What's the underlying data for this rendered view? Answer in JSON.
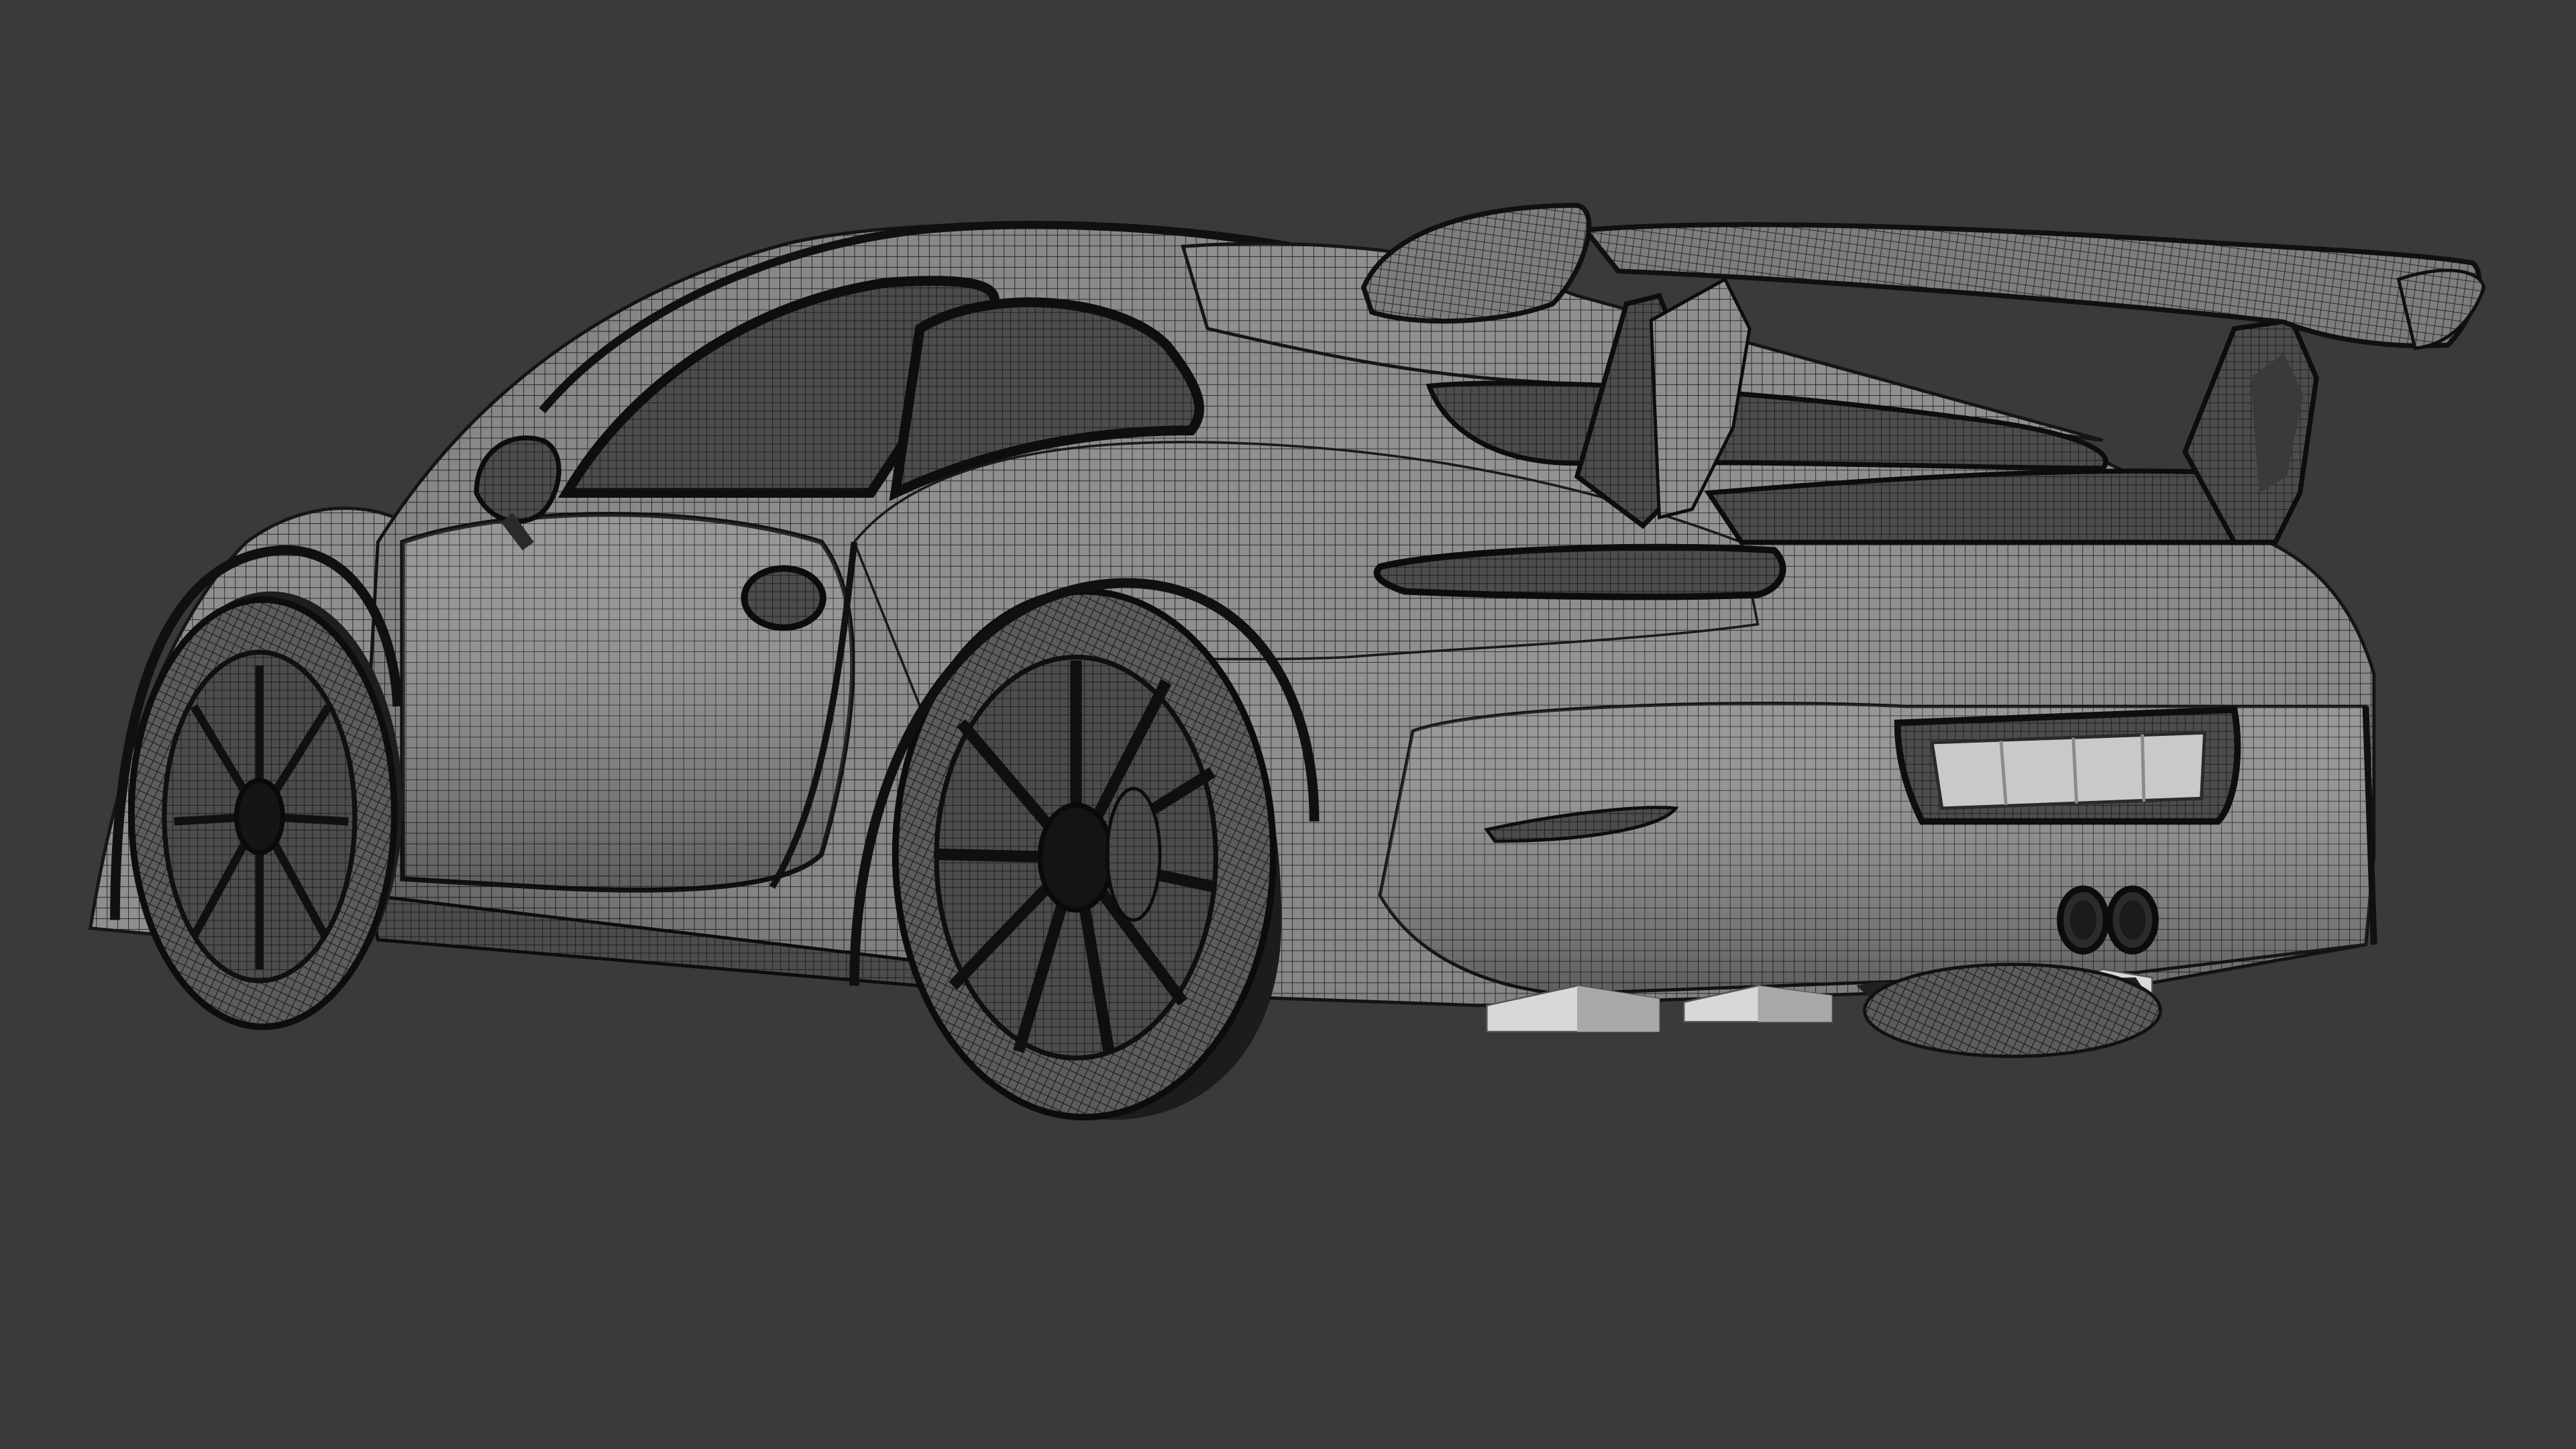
{
  "scene": {
    "subject": "car-wireframe-render",
    "view": "rear-three-quarter",
    "shading": "wireframe-on-shaded",
    "background_color": "#3a3a3a",
    "body_color": "#8f8f8f",
    "body_dark_color": "#4c4c4c",
    "wire_color": "#1e1e1e",
    "shadow_color": "#121212",
    "plate_color": "#c9c9c9",
    "diffuser_fin_color": "#d8d8d8"
  },
  "icons": {
    "model": "sports-car-wireframe-icon"
  }
}
